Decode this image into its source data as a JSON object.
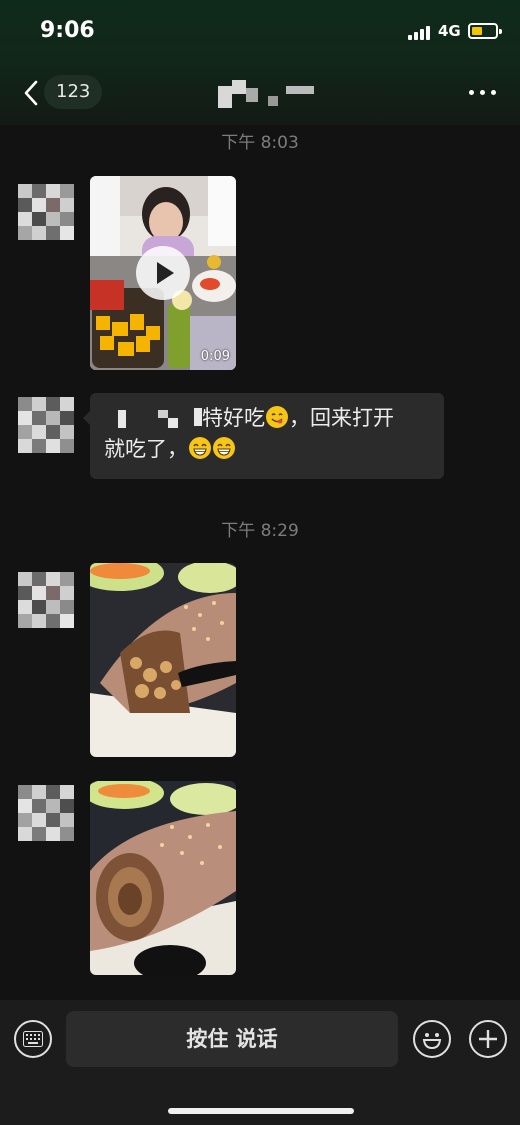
{
  "status_bar": {
    "time": "9:06",
    "network": "4G",
    "battery_color": "#f2c500"
  },
  "nav": {
    "unread_count": "123",
    "contact_name_pixelated": true
  },
  "messages": [
    {
      "type": "timestamp",
      "text": "下午 8:03"
    },
    {
      "type": "video",
      "sender": "contact",
      "duration": "0:09"
    },
    {
      "type": "text",
      "sender": "contact",
      "line1": "特好吃",
      "line1b": "，回来打开",
      "line2": "就吃了，",
      "emojis": [
        "yum-emoji",
        "grin-emoji",
        "grin-emoji"
      ]
    },
    {
      "type": "timestamp",
      "text": "下午 8:29"
    },
    {
      "type": "image",
      "sender": "contact",
      "subject": "chocolate-roll-cake"
    },
    {
      "type": "image",
      "sender": "contact",
      "subject": "chocolate-roll-cake"
    }
  ],
  "input_bar": {
    "hold_to_talk_label": "按住 说话",
    "icons": [
      "keyboard-icon",
      "emoji-icon",
      "plus-icon"
    ]
  }
}
